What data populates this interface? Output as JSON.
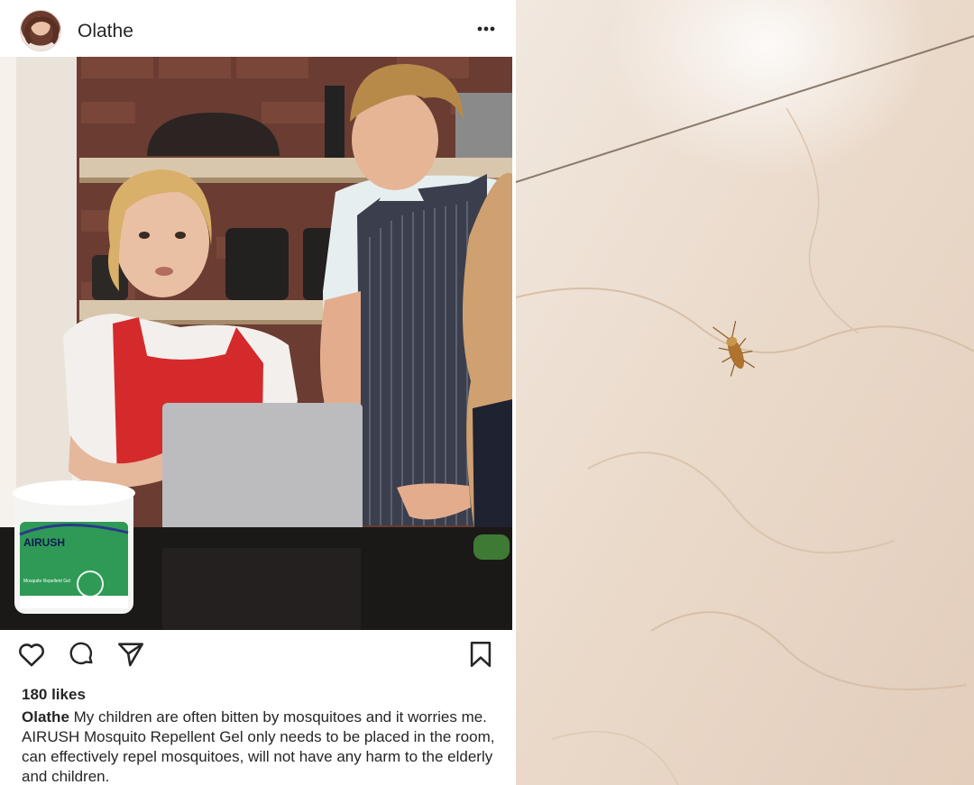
{
  "post": {
    "username": "Olathe",
    "likes": "180 likes",
    "caption_user": "Olathe",
    "caption_text": "My children are often bitten by mosquitoes and it worries me. AIRUSH Mosquito Repellent Gel only needs to be placed in the room, can effectively repel mosquitoes, will not have any harm to the elderly and children.",
    "product": {
      "brand": "AIRUSH",
      "name": "Mosquito Repellent Gel"
    }
  },
  "icons": {
    "more": "more-options-icon",
    "like": "heart-icon",
    "comment": "comment-icon",
    "share": "send-icon",
    "save": "bookmark-icon"
  },
  "colors": {
    "text": "#262626",
    "apron_red": "#d42a2c",
    "product_green": "#2f9a56",
    "wall": "#efe3d6"
  }
}
